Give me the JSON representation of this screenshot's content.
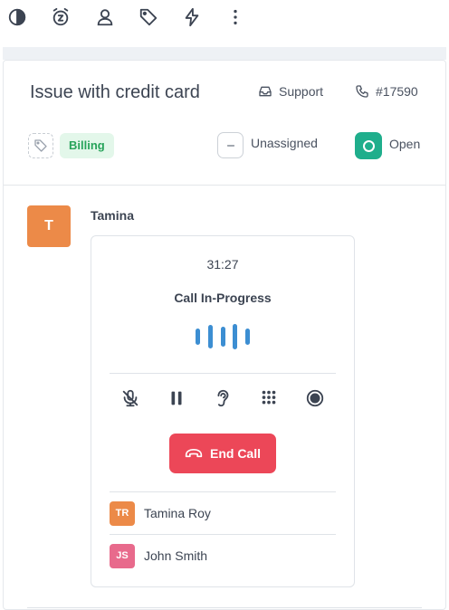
{
  "toolbar": {
    "icons": [
      "contrast-icon",
      "snooze-icon",
      "user-icon",
      "tag-icon",
      "macro-icon",
      "more-icon"
    ]
  },
  "conversation": {
    "title": "Issue with credit card",
    "inbox_label": "Support",
    "ticket_number": "#17590",
    "label_tag": "Billing",
    "assignee_label": "Unassigned",
    "status_label": "Open",
    "colors": {
      "open_status": "#1fae8c",
      "billing_bg": "#e3f7ea",
      "billing_text": "#27a35a"
    }
  },
  "message": {
    "avatar_initial": "T",
    "author": "Tamina",
    "avatar_color": "#ec8a48"
  },
  "call": {
    "timer": "31:27",
    "status": "Call In-Progress",
    "controls": [
      "mute-icon",
      "pause-icon",
      "listen-icon",
      "keypad-icon",
      "record-icon"
    ],
    "end_call_label": "End Call",
    "end_call_color": "#ec4758",
    "participants": [
      {
        "initials": "TR",
        "name": "Tamina Roy",
        "color": "#ec8a48"
      },
      {
        "initials": "JS",
        "name": "John Smith",
        "color": "#e86a8c"
      }
    ]
  }
}
